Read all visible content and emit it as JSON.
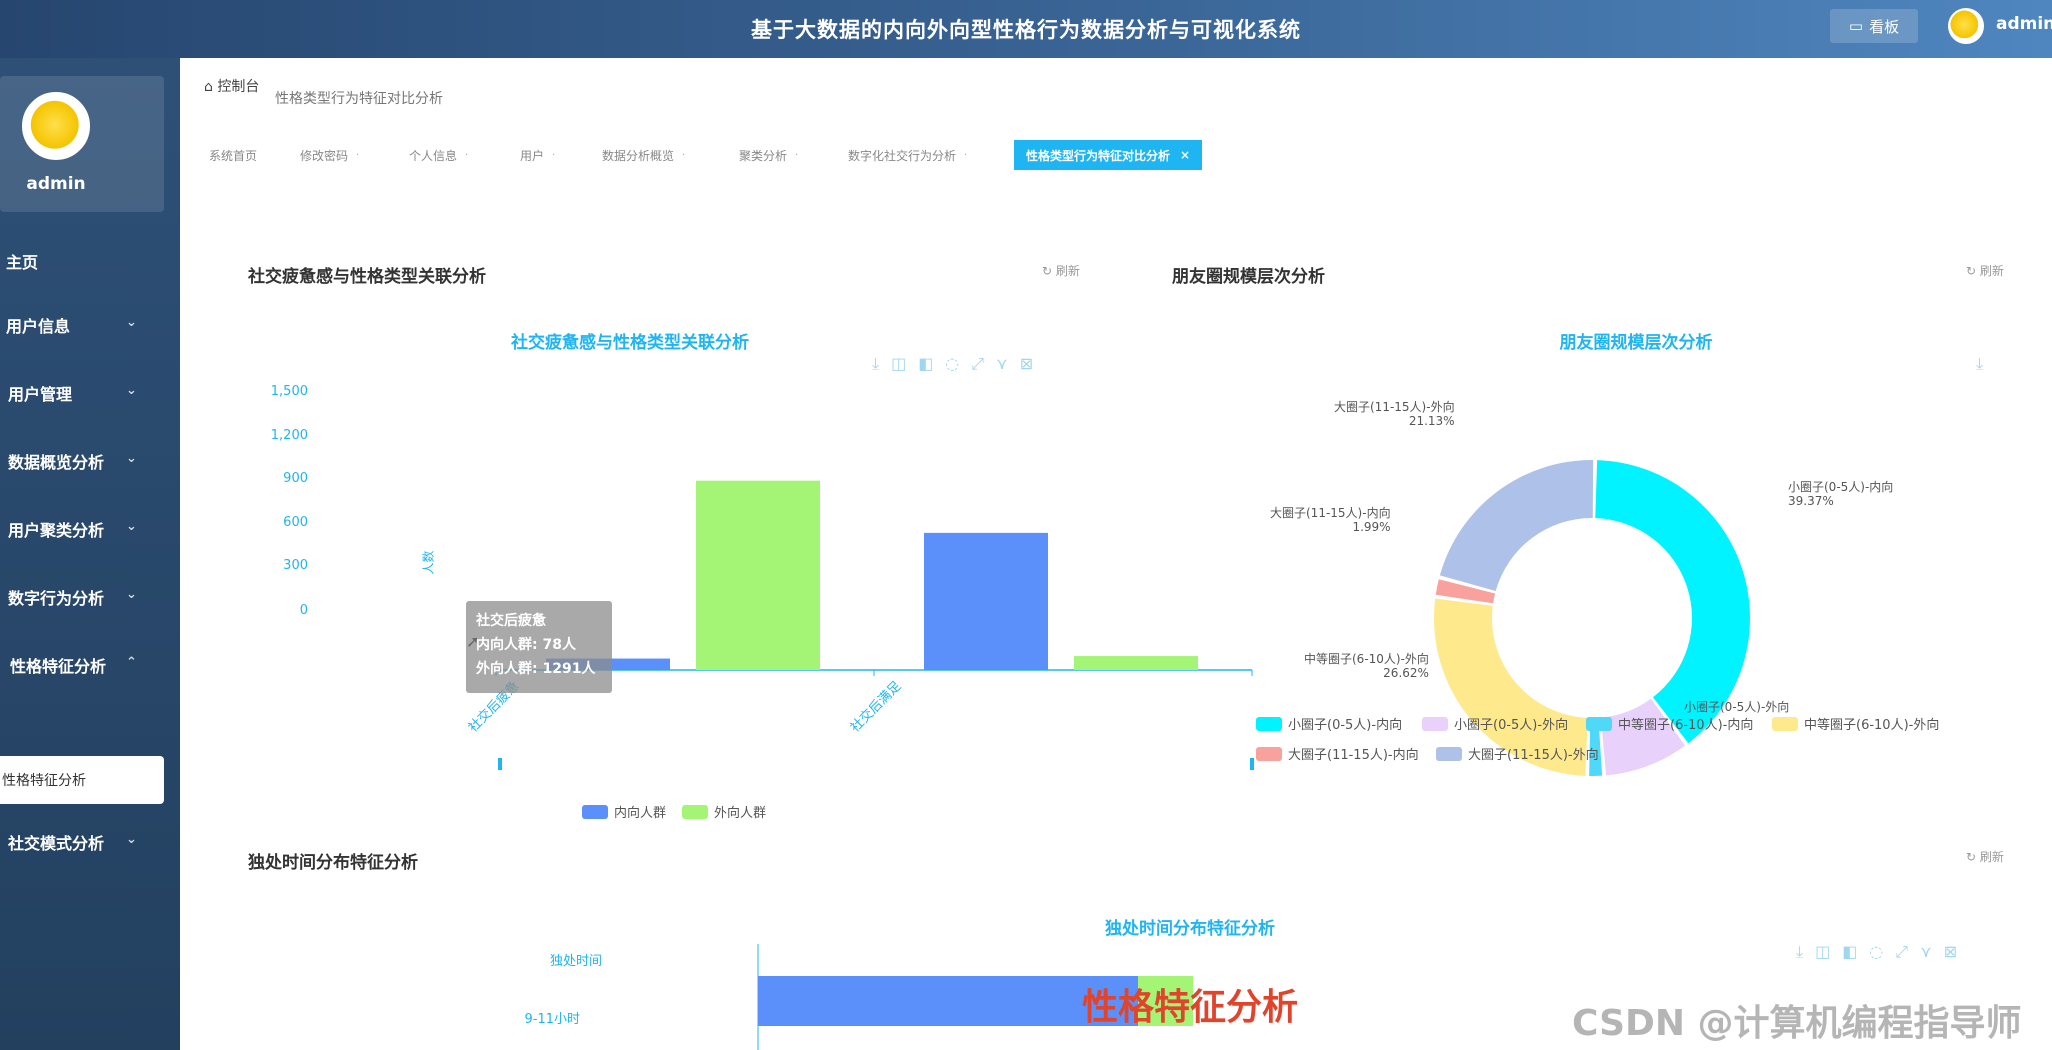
{
  "header": {
    "title": "基于大数据的内向外向型性格行为数据分析与可视化系统",
    "kanban_label": "看板",
    "user": "admin"
  },
  "sidebar": {
    "profile_name": "admin",
    "items": [
      {
        "label": "主页"
      },
      {
        "label": "用户信息"
      },
      {
        "label": "用户管理"
      },
      {
        "label": "数据概览分析"
      },
      {
        "label": "用户聚类分析"
      },
      {
        "label": "数字行为分析"
      },
      {
        "label": "性格特征分析"
      },
      {
        "label": "社交模式分析"
      }
    ],
    "active_sub": "性格特征分析"
  },
  "breadcrumb": {
    "home": "控制台",
    "current": "性格类型行为特征对比分析"
  },
  "tabs": [
    {
      "label": "系统首页"
    },
    {
      "label": "修改密码"
    },
    {
      "label": "个人信息"
    },
    {
      "label": "用户"
    },
    {
      "label": "数据分析概览"
    },
    {
      "label": "聚类分析"
    },
    {
      "label": "数字化社交行为分析"
    },
    {
      "label": "性格类型行为特征对比分析",
      "active": true,
      "close": "×"
    }
  ],
  "panels": {
    "p1": {
      "title": "社交疲惫感与性格类型关联分析",
      "refresh": "刷新"
    },
    "p2": {
      "title": "朋友圈规模层次分析",
      "refresh": "刷新"
    },
    "p3": {
      "title": "独处时间分布特征分析",
      "refresh": "刷新"
    }
  },
  "chart_data": [
    {
      "type": "bar",
      "title": "社交疲惫感与性格类型关联分析",
      "ylabel": "人数",
      "ylim": [
        0,
        1500
      ],
      "yticks": [
        "0",
        "300",
        "600",
        "900",
        "1,200",
        "1,500"
      ],
      "categories": [
        "社交后疲惫",
        "社交后满足"
      ],
      "series": [
        {
          "name": "内向人群",
          "values": [
            78,
            935
          ],
          "color": "#5b8ff9"
        },
        {
          "name": "外向人群",
          "values": [
            1291,
            95
          ],
          "color": "#a4f576"
        }
      ],
      "tooltip": {
        "title": "社交后疲惫",
        "rows": [
          "内向人群: 78人",
          "外向人群: 1291人"
        ]
      }
    },
    {
      "type": "pie",
      "title": "朋友圈规模层次分析",
      "slices": [
        {
          "name": "小圈子(0-5人)-内向",
          "value": 39.37,
          "label": "39.37%",
          "color": "#00f3ff"
        },
        {
          "name": "小圈子(0-5人)-外向",
          "value": 9.0,
          "color": "#e8d2fb"
        },
        {
          "name": "中等圈子(6-10人)-内向",
          "value": 1.7,
          "color": "#4fd8f8"
        },
        {
          "name": "中等圈子(6-10人)-外向",
          "value": 26.62,
          "label": "26.62%",
          "color": "#fee98d"
        },
        {
          "name": "大圈子(11-15人)-内向",
          "value": 1.99,
          "label": "1.99%",
          "color": "#f8a19d"
        },
        {
          "name": "大圈子(11-15人)-外向",
          "value": 21.13,
          "label": "21.13%",
          "color": "#aec2e9"
        }
      ]
    },
    {
      "type": "bar",
      "title": "独处时间分布特征分析",
      "ylabel": "独处时间",
      "categories": [
        "9-11小时"
      ],
      "series": [
        {
          "name": "内向人群",
          "values": [
            760
          ],
          "color": "#5b8ff9"
        },
        {
          "name": "外向人群",
          "values": [
            110
          ],
          "color": "#a4f576"
        }
      ]
    }
  ],
  "overlay": {
    "text": "性格特征分析"
  },
  "watermark": "CSDN @计算机编程指导师"
}
